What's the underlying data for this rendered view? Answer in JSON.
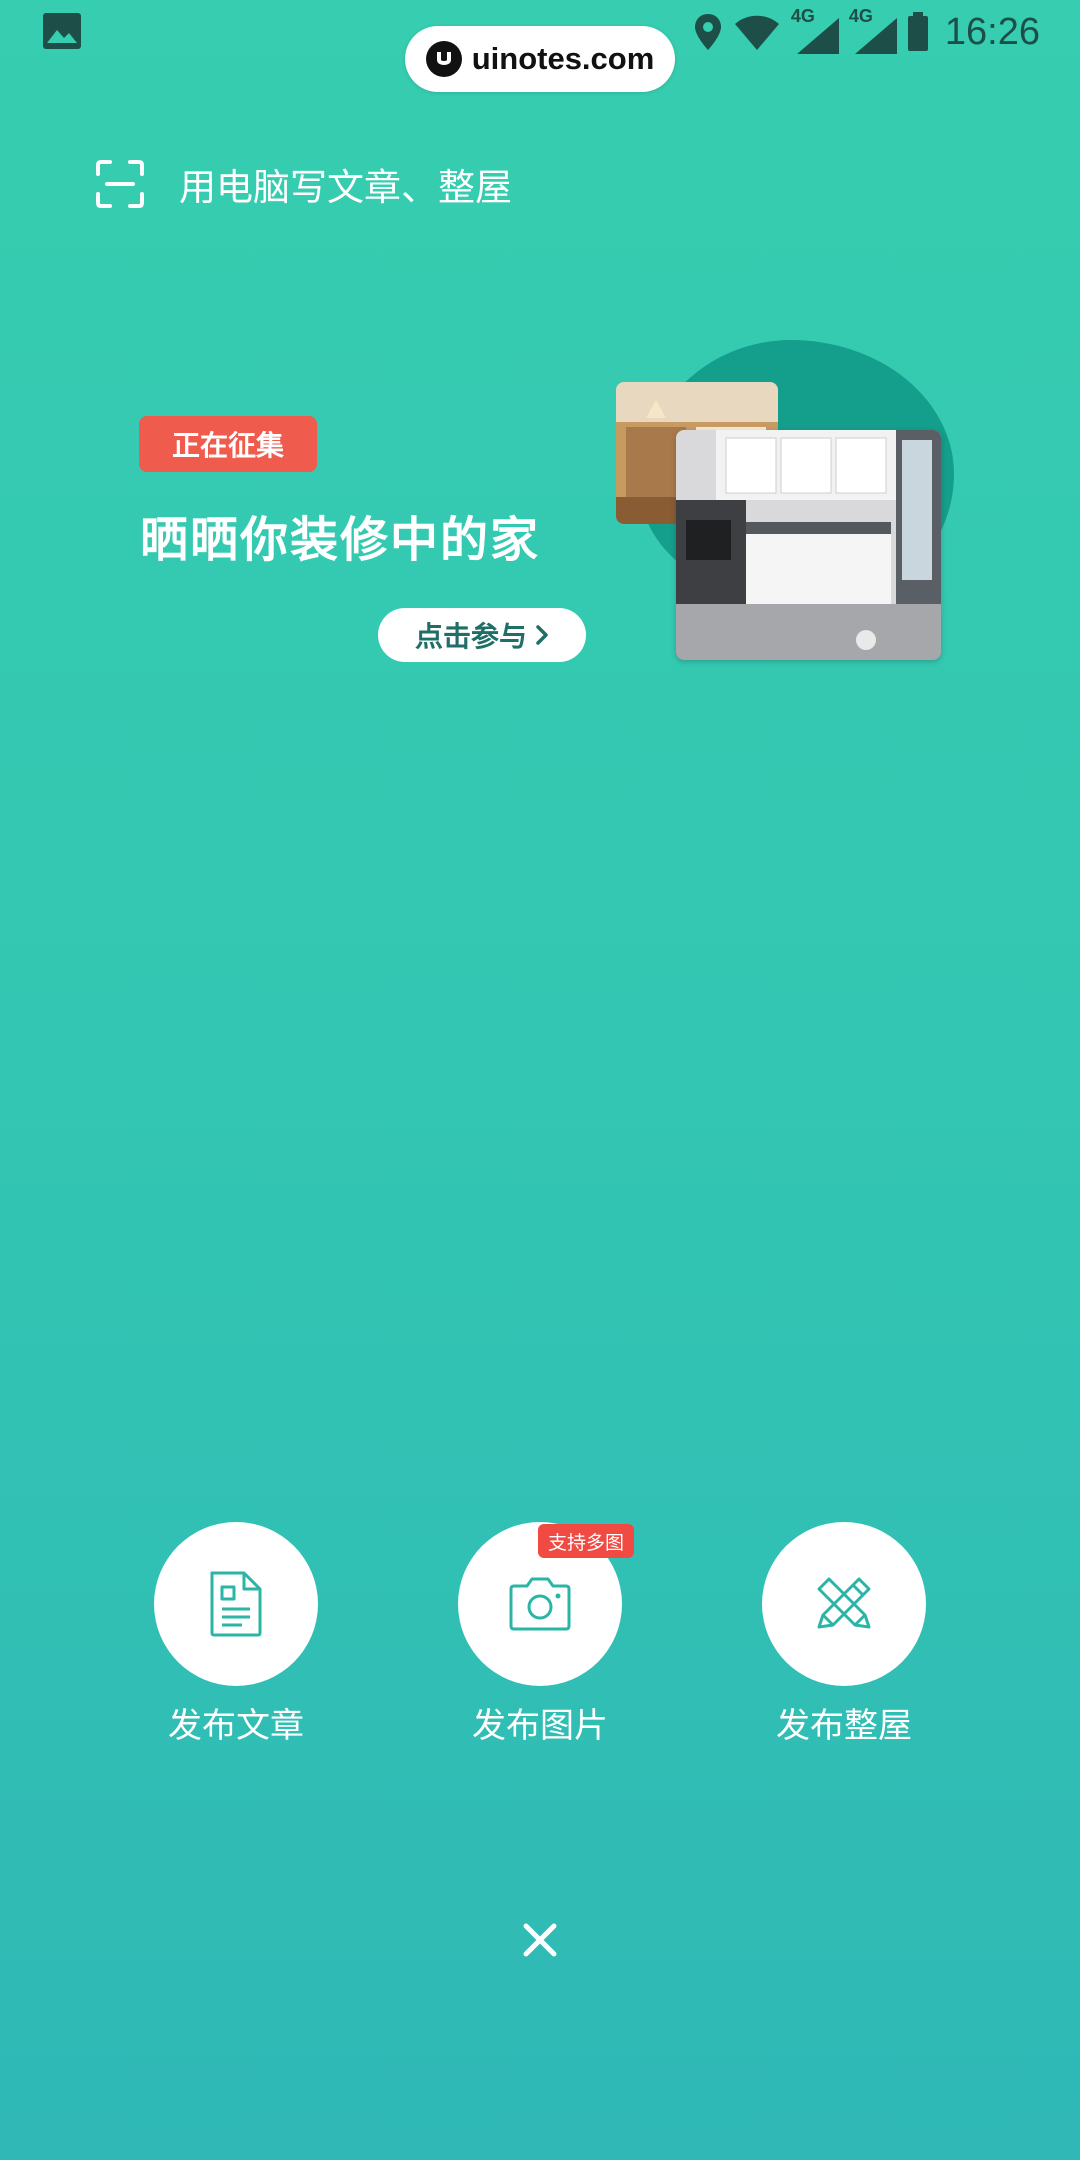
{
  "status_bar": {
    "time": "16:26",
    "network_1": "4G",
    "network_2": "4G",
    "icons": [
      "gallery-icon",
      "location-icon",
      "wifi-icon",
      "signal-icon",
      "battery-icon"
    ]
  },
  "watermark": {
    "text": "uinotes.com"
  },
  "scan": {
    "icon": "scan-icon",
    "text": "用电脑写文章、整屋"
  },
  "banner": {
    "tag": "正在征集",
    "title": "晒晒你装修中的家",
    "cta": "点击参与",
    "cta_icon": "chevron-right-icon"
  },
  "actions": [
    {
      "label": "发布文章",
      "icon": "document-icon"
    },
    {
      "label": "发布图片",
      "icon": "camera-icon",
      "badge": "支持多图"
    },
    {
      "label": "发布整屋",
      "icon": "tools-icon"
    }
  ],
  "close": {
    "icon": "close-icon"
  },
  "colors": {
    "background_top": "#36cdb0",
    "background_bottom": "#2fb8b6",
    "tag_red": "#ef5b4c",
    "badge_red": "#f04a43",
    "icon_teal": "#2bb5a6",
    "blob": "#149e8c"
  }
}
